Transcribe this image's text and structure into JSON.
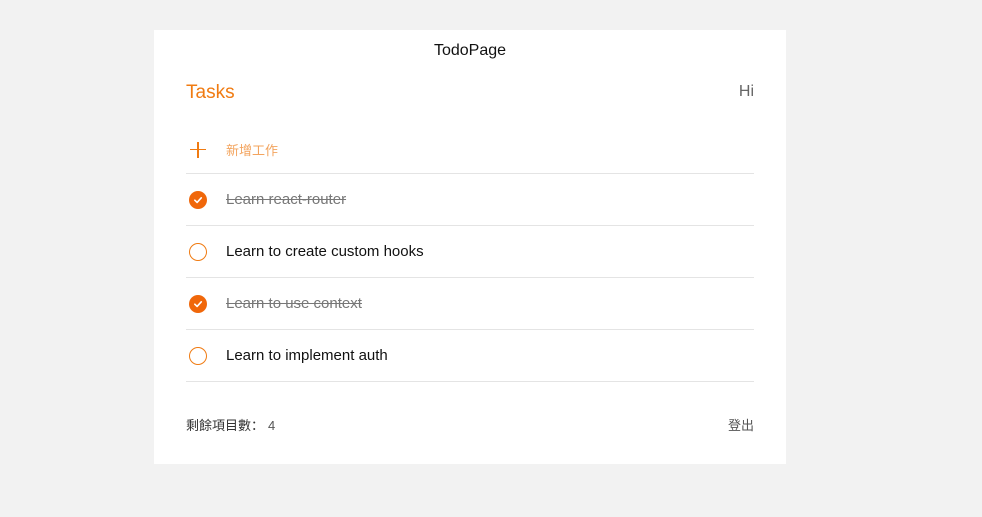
{
  "page": {
    "title": "TodoPage"
  },
  "header": {
    "tasks_label": "Tasks",
    "greeting": "Hi"
  },
  "add": {
    "label": "新增工作",
    "icon": "plus-icon"
  },
  "todos": [
    {
      "text": "Learn react-router",
      "completed": true
    },
    {
      "text": "Learn to create custom hooks",
      "completed": false
    },
    {
      "text": "Learn to use context",
      "completed": true
    },
    {
      "text": "Learn to implement auth",
      "completed": false
    }
  ],
  "footer": {
    "remaining_label": "剩餘項目數：",
    "remaining_count": "4",
    "logout_label": "登出"
  },
  "colors": {
    "accent": "#f07b12",
    "check_filled": "#f0670a",
    "background": "#f2f2f2"
  }
}
